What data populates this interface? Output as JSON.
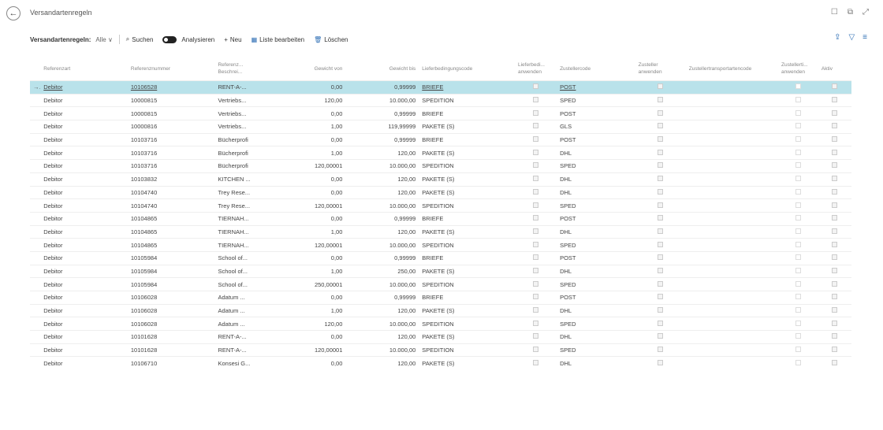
{
  "window": {
    "title": "Versandartenregeln"
  },
  "toolbar": {
    "caption": "Versandartenregeln:",
    "filter": "Alle ∨",
    "search": "Suchen",
    "analyze": "Analysieren",
    "new": "Neu",
    "edit_list": "Liste bearbeiten",
    "delete": "Löschen"
  },
  "columns": [
    "Referenzart",
    "Referenznummer",
    "Referenz... Beschrei...",
    "Gewicht von",
    "Gewicht bis",
    "Lieferbedingungscode",
    "Lieferbedi... anwenden",
    "Zustellercode",
    "Zusteller anwenden",
    "Zustellertransportartencode",
    "Zustellerti... anwenden",
    "Aktiv"
  ],
  "rows": [
    {
      "art": "Debitor",
      "nr": "10106528",
      "besch": "RENT-A-...",
      "von": "0,00",
      "bis": "0,99999",
      "lief": "BRIEFE",
      "zust": "POST",
      "selected": true
    },
    {
      "art": "Debitor",
      "nr": "10000815",
      "besch": "Vertriebs...",
      "von": "120,00",
      "bis": "10.000,00",
      "lief": "SPEDITION",
      "zust": "SPED"
    },
    {
      "art": "Debitor",
      "nr": "10000815",
      "besch": "Vertriebs...",
      "von": "0,00",
      "bis": "0,99999",
      "lief": "BRIEFE",
      "zust": "POST"
    },
    {
      "art": "Debitor",
      "nr": "10000816",
      "besch": "Vertriebs...",
      "von": "1,00",
      "bis": "119,99999",
      "lief": "PAKETE (S)",
      "zust": "GLS"
    },
    {
      "art": "Debitor",
      "nr": "10103716",
      "besch": "Bücherprofi",
      "von": "0,00",
      "bis": "0,99999",
      "lief": "BRIEFE",
      "zust": "POST"
    },
    {
      "art": "Debitor",
      "nr": "10103716",
      "besch": "Bücherprofi",
      "von": "1,00",
      "bis": "120,00",
      "lief": "PAKETE (S)",
      "zust": "DHL"
    },
    {
      "art": "Debitor",
      "nr": "10103716",
      "besch": "Bücherprofi",
      "von": "120,00001",
      "bis": "10.000,00",
      "lief": "SPEDITION",
      "zust": "SPED"
    },
    {
      "art": "Debitor",
      "nr": "10103832",
      "besch": "KITCHEN ...",
      "von": "0,00",
      "bis": "120,00",
      "lief": "PAKETE (S)",
      "zust": "DHL"
    },
    {
      "art": "Debitor",
      "nr": "10104740",
      "besch": "Trey Rese...",
      "von": "0,00",
      "bis": "120,00",
      "lief": "PAKETE (S)",
      "zust": "DHL"
    },
    {
      "art": "Debitor",
      "nr": "10104740",
      "besch": "Trey Rese...",
      "von": "120,00001",
      "bis": "10.000,00",
      "lief": "SPEDITION",
      "zust": "SPED"
    },
    {
      "art": "Debitor",
      "nr": "10104865",
      "besch": "TIERNAH...",
      "von": "0,00",
      "bis": "0,99999",
      "lief": "BRIEFE",
      "zust": "POST"
    },
    {
      "art": "Debitor",
      "nr": "10104865",
      "besch": "TIERNAH...",
      "von": "1,00",
      "bis": "120,00",
      "lief": "PAKETE (S)",
      "zust": "DHL"
    },
    {
      "art": "Debitor",
      "nr": "10104865",
      "besch": "TIERNAH...",
      "von": "120,00001",
      "bis": "10.000,00",
      "lief": "SPEDITION",
      "zust": "SPED"
    },
    {
      "art": "Debitor",
      "nr": "10105984",
      "besch": "School of...",
      "von": "0,00",
      "bis": "0,99999",
      "lief": "BRIEFE",
      "zust": "POST"
    },
    {
      "art": "Debitor",
      "nr": "10105984",
      "besch": "School of...",
      "von": "1,00",
      "bis": "250,00",
      "lief": "PAKETE (S)",
      "zust": "DHL"
    },
    {
      "art": "Debitor",
      "nr": "10105984",
      "besch": "School of...",
      "von": "250,00001",
      "bis": "10.000,00",
      "lief": "SPEDITION",
      "zust": "SPED"
    },
    {
      "art": "Debitor",
      "nr": "10106028",
      "besch": "Adatum ...",
      "von": "0,00",
      "bis": "0,99999",
      "lief": "BRIEFE",
      "zust": "POST"
    },
    {
      "art": "Debitor",
      "nr": "10106028",
      "besch": "Adatum ...",
      "von": "1,00",
      "bis": "120,00",
      "lief": "PAKETE (S)",
      "zust": "DHL"
    },
    {
      "art": "Debitor",
      "nr": "10106028",
      "besch": "Adatum ...",
      "von": "120,00",
      "bis": "10.000,00",
      "lief": "SPEDITION",
      "zust": "SPED"
    },
    {
      "art": "Debitor",
      "nr": "10101628",
      "besch": "RENT-A-...",
      "von": "0,00",
      "bis": "120,00",
      "lief": "PAKETE (S)",
      "zust": "DHL"
    },
    {
      "art": "Debitor",
      "nr": "10101628",
      "besch": "RENT-A-...",
      "von": "120,00001",
      "bis": "10.000,00",
      "lief": "SPEDITION",
      "zust": "SPED"
    },
    {
      "art": "Debitor",
      "nr": "10106710",
      "besch": "Konsesi G...",
      "von": "0,00",
      "bis": "120,00",
      "lief": "PAKETE (S)",
      "zust": "DHL"
    }
  ]
}
